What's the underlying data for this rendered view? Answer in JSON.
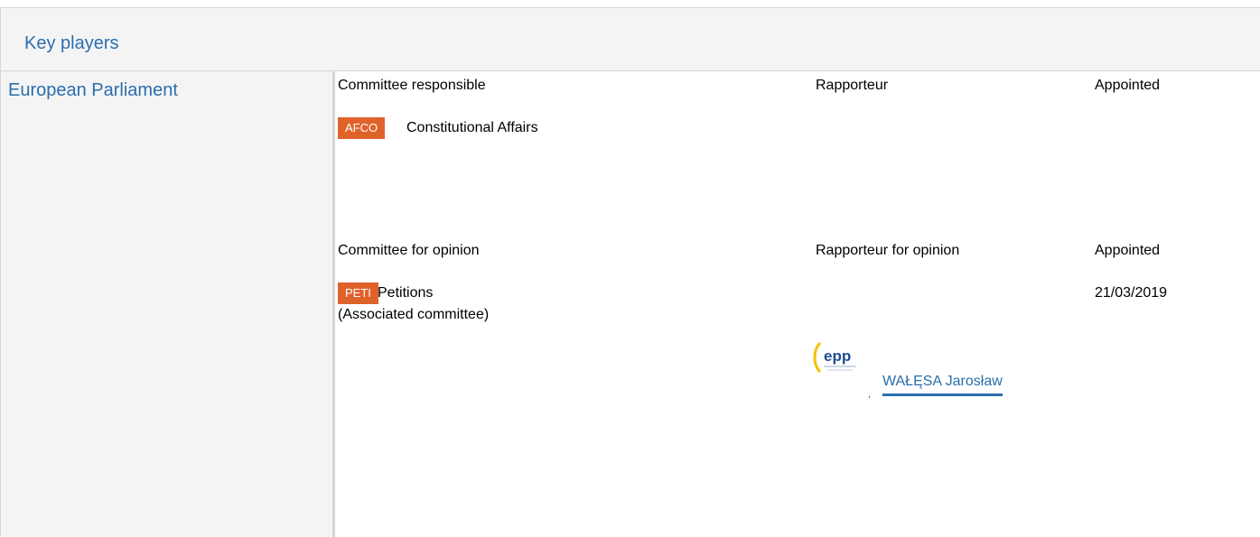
{
  "header": {
    "title": "Key players"
  },
  "institution": {
    "name": "European Parliament"
  },
  "responsible": {
    "committee_heading": "Committee responsible",
    "rapporteur_heading": "Rapporteur",
    "appointed_heading": "Appointed",
    "committee": {
      "code": "AFCO",
      "name": "Constitutional Affairs"
    }
  },
  "opinion": {
    "committee_heading": "Committee for opinion",
    "rapporteur_heading": "Rapporteur for opinion",
    "appointed_heading": "Appointed",
    "committee": {
      "code": "PETI",
      "name": "Petitions",
      "note": "(Associated committee)"
    },
    "appointed_date": "21/03/2019",
    "rapporteur": {
      "name": "WAŁĘSA Jarosław",
      "group_logo": "epp",
      "group_icon": "epp-logo-icon",
      "trailing_mark": ","
    }
  },
  "colors": {
    "link": "#2a6ead",
    "badge": "#e0622b",
    "header_bg": "#f4f4f4",
    "border": "#d6d6d6"
  }
}
